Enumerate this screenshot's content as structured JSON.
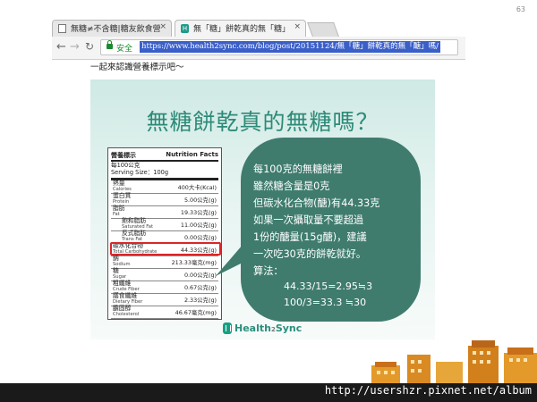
{
  "slide_number": "63",
  "browser": {
    "tabs": [
      {
        "title": "無糖≠不含糖|糖友飲食營",
        "active": false
      },
      {
        "title": "無「糖」餅乾真的無「糖」",
        "active": true
      }
    ],
    "address": {
      "security_label": "安全",
      "url": "https://www.health2sync.com/blog/post/20151124/無「糖」餅乾真的無「醣」嗎/"
    }
  },
  "page_caption": "一起來認識營養標示吧～",
  "slide": {
    "title": "無糖餅乾真的無糖嗎？",
    "nutrition_label": {
      "header_zh": "營養標示",
      "header_en": "Nutrition Facts",
      "serving_per": "每100公克",
      "serving_size": "Serving Size：100g",
      "rows": [
        {
          "zh": "熱量",
          "en": "Calories",
          "value": "400大卡(Kcal)",
          "sub": false
        },
        {
          "zh": "蛋白質",
          "en": "Protein",
          "value": "5.00公克(g)",
          "sub": false
        },
        {
          "zh": "脂肪",
          "en": "Fat",
          "value": "19.33公克(g)",
          "sub": false
        },
        {
          "zh": "飽和脂肪",
          "en": "Saturated Fat",
          "value": "11.00公克(g)",
          "sub": true
        },
        {
          "zh": "反式脂肪",
          "en": "Trans Fat",
          "value": "0.00公克(g)",
          "sub": true
        },
        {
          "zh": "碳水化合物",
          "en": "Total Carbohydrate",
          "value": "44.33公克(g)",
          "sub": false
        },
        {
          "zh": "鈉",
          "en": "Sodium",
          "value": "213.33毫克(mg)",
          "sub": false
        },
        {
          "zh": "糖",
          "en": "Sugar",
          "value": "0.00公克(g)",
          "sub": false
        },
        {
          "zh": "粗纖維",
          "en": "Crude Fiber",
          "value": "0.67公克(g)",
          "sub": false
        },
        {
          "zh": "膳食纖維",
          "en": "Dietary Fiber",
          "value": "2.33公克(g)",
          "sub": false
        },
        {
          "zh": "膽固醇",
          "en": "Cholesterol",
          "value": "46.67毫克(mg)",
          "sub": false
        }
      ]
    },
    "bubble": {
      "lines": [
        "每100克的無糖餅裡",
        "雖然糖含量是0克",
        "但碳水化合物(醣)有44.33克",
        "如果一次攝取量不要超過",
        "1份的醣量(15g醣)，建議",
        "一次吃30克的餅乾就好。",
        "算法："
      ],
      "calc": [
        "44.33/15=2.95≒3",
        "100/3=33.3 ≒30"
      ]
    },
    "brand": {
      "name": "Health",
      "two": "2",
      "tail": "Sync"
    }
  },
  "watermark": "http://usershzr.pixnet.net/album"
}
